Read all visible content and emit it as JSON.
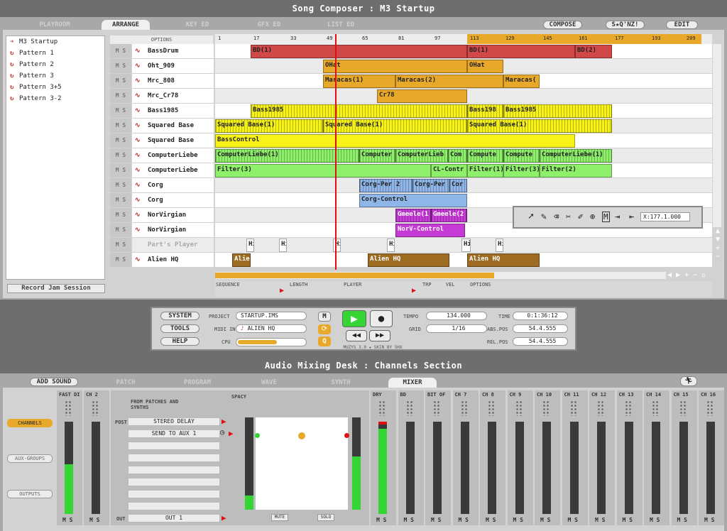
{
  "song_composer": {
    "title": "Song Composer : M3 Startup",
    "tabs": [
      "PLAYROOM",
      "ARRANGE",
      "KEY ED",
      "GFX ED",
      "LIST ED"
    ],
    "right_tabs": [
      "COMPOSE",
      "S★Q'NZ!",
      "EDIT"
    ],
    "options_label": "OPTIONS",
    "ruler": [
      "1",
      "17",
      "33",
      "49",
      "65",
      "81",
      "97",
      "113",
      "129",
      "145",
      "161",
      "177",
      "193",
      "209"
    ],
    "patterns": [
      "M3 Startup",
      "Pattern 1",
      "Pattern 2",
      "Pattern 3",
      "Pattern 3+5",
      "Pattern 3-2"
    ],
    "record_jam": "Record Jam Session",
    "tracks": [
      {
        "name": "BassDrum",
        "blocks": [
          "BD(1)",
          "BD(1)",
          "BD(2)"
        ]
      },
      {
        "name": "Oht_909",
        "blocks": [
          "OHat",
          "OHat"
        ]
      },
      {
        "name": "Mrc_808",
        "blocks": [
          "Maracas(1)",
          "Maracas(2)",
          "Maracas("
        ]
      },
      {
        "name": "Mrc_Cr78",
        "blocks": [
          "Cr78"
        ]
      },
      {
        "name": "Bass1985",
        "blocks": [
          "Bass1985",
          "Bass198",
          "Bass1985"
        ]
      },
      {
        "name": "Squared Base",
        "blocks": [
          "Squared Base(1)",
          "Squared Base(1)",
          "Squared Base(1)"
        ]
      },
      {
        "name": "Squared Base",
        "blocks": [
          "BassControl"
        ]
      },
      {
        "name": "ComputerLiebe",
        "blocks": [
          "ComputerLiebe(1)",
          "Computer",
          "ComputerLieb",
          "Com",
          "Compute",
          "Compute",
          "ComputerLiebe(1)"
        ]
      },
      {
        "name": "ComputerLiebe",
        "blocks": [
          "Filter(3)",
          "CL-Contr",
          "Filter(1)",
          "Filter(3)",
          "Filter(2)"
        ]
      },
      {
        "name": "Corg",
        "blocks": [
          "Corg-Per 2",
          "Corg-Per",
          "Cor"
        ]
      },
      {
        "name": "Corg",
        "blocks": [
          "Corg-Control"
        ]
      },
      {
        "name": "NorVirgian",
        "blocks": [
          "Gmeele(1",
          "Gmeele(2"
        ]
      },
      {
        "name": "NorVirgian",
        "blocks": [
          "NorV-Control"
        ]
      },
      {
        "name": "Part's Player",
        "blocks": [
          "Hi",
          "Hi",
          "Hi",
          "Hi",
          "Hi",
          "Hi"
        ]
      },
      {
        "name": "Alien HQ",
        "blocks": [
          "Alier",
          "Alien HQ",
          "Alien HQ"
        ]
      }
    ],
    "tool_coord": "X:177.1.000",
    "footer_labels": [
      "SEQUENCE",
      "LENGTH",
      "PLAYER",
      "TRP",
      "VEL",
      "OPTIONS"
    ]
  },
  "transport": {
    "buttons": [
      "SYSTEM",
      "TOOLS",
      "HELP"
    ],
    "project_label": "PROJECT",
    "project_value": "STARTUP.IMS",
    "midi_label": "MIDI IN",
    "midi_value": "ALIEN HQ",
    "cpu_label": "CPU",
    "tempo_label": "TEMPO",
    "tempo_value": "134.000",
    "grid_label": "GRID",
    "grid_value": "1/16",
    "time_label": "TIME",
    "time_value": "0:1:36:12",
    "abspos_label": "ABS.POS",
    "abspos_value": "54.4.555",
    "relpos_label": "REL.POS",
    "relpos_value": "54.4.555",
    "brand": "MUZYS 3.0 ★ SKIN BY SHX",
    "m_label": "M",
    "q_label": "Q"
  },
  "mixer": {
    "title": "Audio Mixing Desk : Channels Section",
    "tabs": [
      "ADD SOUND",
      "PATCH",
      "PROGRAM",
      "WAVE",
      "SYNTH",
      "MIXER"
    ],
    "side_buttons": [
      "CHANNELS",
      "AUX-GROUPS",
      "OUTPUTS"
    ],
    "channels_left": [
      "FAST DI",
      "CH 2"
    ],
    "from_patches": "FROM PATCHES AND SYNTHS",
    "post_label": "POST",
    "sends": [
      "STEREO DELAY",
      "SEND TO AUX 1"
    ],
    "out_label": "OUT",
    "out_value": "OUT 1",
    "spacy": "SPACY",
    "mute": "MUTE",
    "solo": "SOLO",
    "channels_right": [
      "DRY",
      "BD",
      "BIT OF",
      "CH 7",
      "CH 8",
      "CH 9",
      "CH 10",
      "CH 11",
      "CH 12",
      "CH 13",
      "CH 14",
      "CH 15",
      "CH 16"
    ],
    "ms_label": "M S"
  }
}
